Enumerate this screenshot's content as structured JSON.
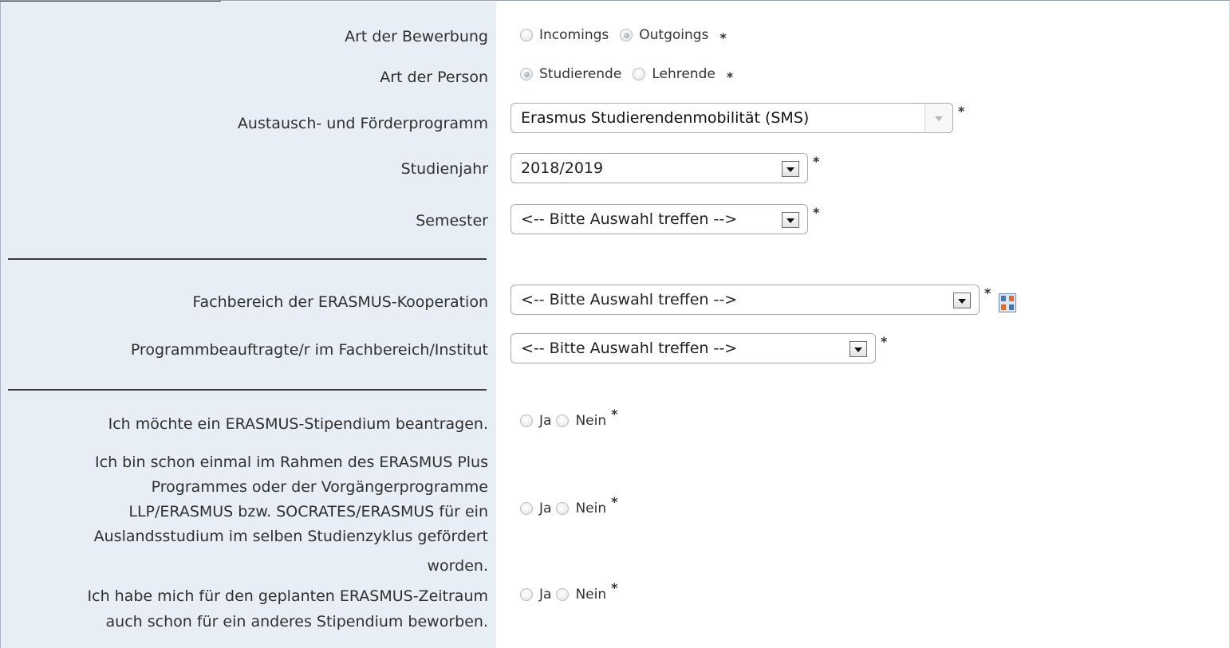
{
  "form": {
    "art_bewerbung": {
      "label": "Art der Bewerbung",
      "options": [
        "Incomings",
        "Outgoings"
      ],
      "selected": "Outgoings"
    },
    "art_person": {
      "label": "Art der Person",
      "options": [
        "Studierende",
        "Lehrende"
      ],
      "selected": "Studierende"
    },
    "programm": {
      "label": "Austausch- und Förderprogramm",
      "value": "Erasmus Studierendenmobilität (SMS)"
    },
    "studienjahr": {
      "label": "Studienjahr",
      "value": "2018/2019"
    },
    "semester": {
      "label": "Semester",
      "value": "<-- Bitte Auswahl treffen -->"
    },
    "fachbereich": {
      "label": "Fachbereich der ERASMUS-Kooperation",
      "value": "<-- Bitte Auswahl treffen -->"
    },
    "programmbeauftragte": {
      "label": "Programmbeauftragte/r im Fachbereich/Institut",
      "value": "<-- Bitte Auswahl treffen -->"
    },
    "stipendium": {
      "label": "Ich möchte ein ERASMUS-Stipendium beantragen.",
      "yes": "Ja",
      "no": "Nein"
    },
    "gefoerdert": {
      "label_lines": [
        "Ich bin schon einmal im Rahmen des ERASMUS Plus",
        "Programmes oder der Vorgängerprogramme",
        "LLP/ERASMUS bzw. SOCRATES/ERASMUS für ein",
        "Auslandsstudium im selben Studienzyklus gefördert",
        "worden."
      ],
      "yes": "Ja",
      "no": "Nein"
    },
    "anderes_stipendium": {
      "label_lines": [
        "Ich habe mich für den geplanten ERASMUS-Zeitraum",
        "auch schon für ein anderes Stipendium beworben."
      ],
      "yes": "Ja",
      "no": "Nein"
    },
    "required_marker": "*"
  },
  "icons": {
    "sort": "sort-az-icon"
  },
  "colors": {
    "label_background": "#e8eef6",
    "top_accent": "#1b4f8f"
  }
}
